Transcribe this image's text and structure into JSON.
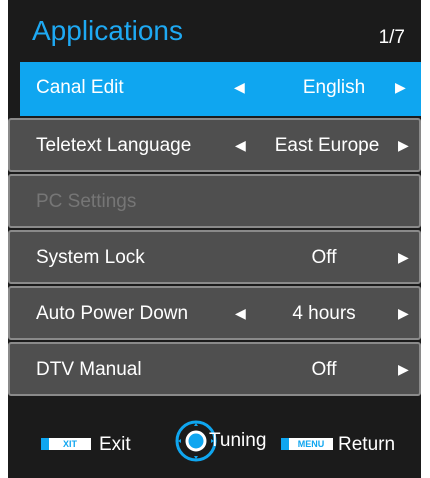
{
  "header": {
    "title": "Applications",
    "page": "1/7"
  },
  "rows": [
    {
      "label": "Canal Edit",
      "value": "English",
      "left_arrow": "◀",
      "right_arrow": "▶"
    },
    {
      "label": "Teletext Language",
      "value": "East Europe",
      "left_arrow": "◀",
      "right_arrow": "▶"
    },
    {
      "label": "PC Settings",
      "value": "",
      "left_arrow": "",
      "right_arrow": ""
    },
    {
      "label": "System Lock",
      "value": "Off",
      "left_arrow": "",
      "right_arrow": "▶"
    },
    {
      "label": "Auto Power Down",
      "value": "4 hours",
      "left_arrow": "◀",
      "right_arrow": "▶"
    },
    {
      "label": "DTV Manual",
      "value": "Off",
      "left_arrow": "",
      "right_arrow": "▶"
    }
  ],
  "footer": {
    "exit_key": "XIT",
    "exit_label": "Exit",
    "tuning_label": "Tuning",
    "menu_key": "MENU",
    "return_label": "Return"
  },
  "colors": {
    "accent": "#0fa6f0",
    "title": "#1ea9f3",
    "row_bg": "#4f4f4f",
    "bg": "#1b1b1b"
  }
}
